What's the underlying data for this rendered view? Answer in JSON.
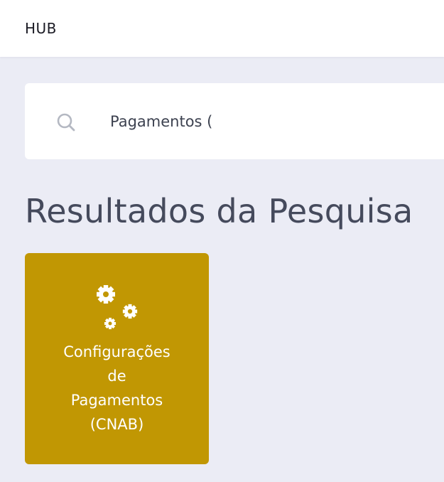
{
  "header": {
    "brand": "HUB"
  },
  "search": {
    "icon": "search-icon",
    "value": "Pagamentos ("
  },
  "results": {
    "title": "Resultados da Pesquisa",
    "items": [
      {
        "icon": "gears-icon",
        "label_lines": [
          "Configurações",
          "de",
          "Pagamentos",
          "(CNAB)"
        ],
        "color": "#c19703"
      }
    ]
  },
  "colors": {
    "background": "#ebecf5",
    "card": "#c19703",
    "title": "#454a5c"
  }
}
